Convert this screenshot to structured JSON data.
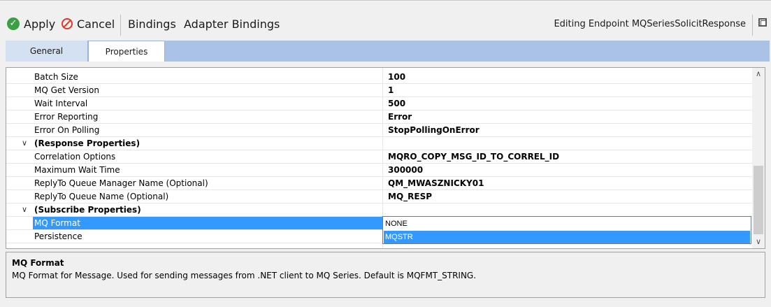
{
  "toolbar": {
    "apply_label": "Apply",
    "cancel_label": "Cancel",
    "bindings_label": "Bindings",
    "adapter_bindings_label": "Adapter Bindings",
    "title": "Editing Endpoint MQSeriesSolicitResponse"
  },
  "tabs": [
    {
      "label": "General"
    },
    {
      "label": "Properties"
    }
  ],
  "grid": {
    "rows": [
      {
        "name": "Batch Size",
        "value": "100"
      },
      {
        "name": "MQ Get Version",
        "value": "1"
      },
      {
        "name": "Wait Interval",
        "value": "500"
      },
      {
        "name": "Error Reporting",
        "value": "Error"
      },
      {
        "name": "Error On Polling",
        "value": "StopPollingOnError"
      },
      {
        "name": "(Response Properties)",
        "value": ""
      },
      {
        "name": "Correlation Options",
        "value": "MQRO_COPY_MSG_ID_TO_CORREL_ID"
      },
      {
        "name": "Maximum Wait Time",
        "value": "300000"
      },
      {
        "name": "ReplyTo Queue Manager Name (Optional)",
        "value": "QM_MWASZNICKY01"
      },
      {
        "name": "ReplyTo Queue Name (Optional)",
        "value": "MQ_RESP"
      },
      {
        "name": "(Subscribe Properties)",
        "value": ""
      },
      {
        "name": "MQ Format",
        "value": ""
      },
      {
        "name": "Persistence",
        "value": ""
      }
    ],
    "dropdown_options": [
      "NONE",
      "MQSTR"
    ],
    "dropdown_selected": "MQSTR"
  },
  "description": {
    "title": "MQ Format",
    "text": "MQ Format for Message. Used for sending messages from .NET client to MQ Series. Default is MQFMT_STRING."
  },
  "colors": {
    "selection": "#3399ff",
    "tab_bar": "#a9c2e6"
  },
  "icons": [
    "check-circle-icon",
    "cancel-circle-icon",
    "maximize-icon",
    "chevron-down-icon",
    "scroll-up-icon",
    "scroll-down-icon"
  ]
}
